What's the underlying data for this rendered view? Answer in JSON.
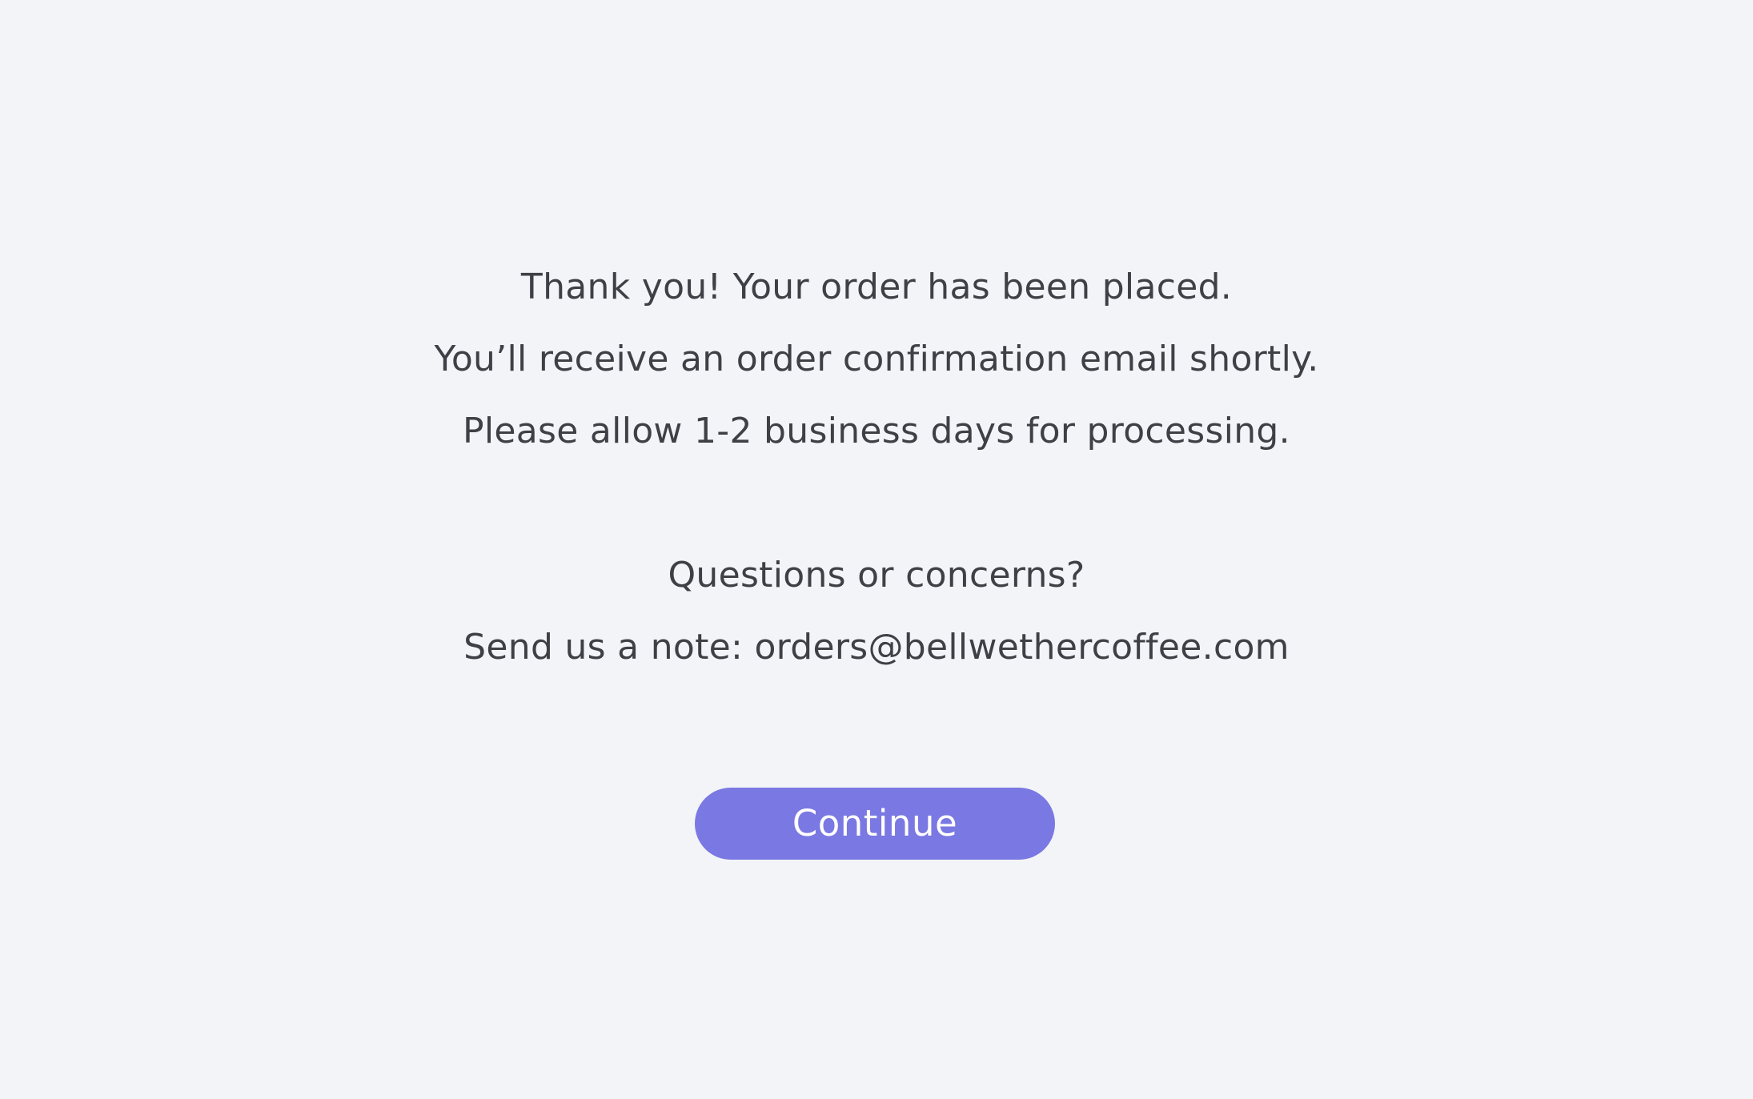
{
  "confirmation": {
    "line1": "Thank you! Your order has been placed.",
    "line2": "You’ll receive an order confirmation email shortly.",
    "line3": "Please allow 1-2 business days for processing."
  },
  "contact": {
    "heading": "Questions or concerns?",
    "note": "Send us a note: orders@bellwethercoffee.com"
  },
  "actions": {
    "continue_label": "Continue"
  },
  "colors": {
    "background": "#f3f4f8",
    "text": "#3f3f46",
    "accent": "#7a78e2",
    "button_text": "#ffffff"
  }
}
